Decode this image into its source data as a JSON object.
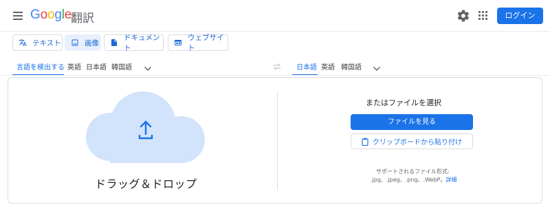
{
  "header": {
    "logo": {
      "g1": "G",
      "o1": "o",
      "o2": "o",
      "g2": "g",
      "l": "l",
      "e": "e"
    },
    "product": "翻訳",
    "login_label": "ログイン"
  },
  "modes": [
    {
      "label": "テキスト",
      "icon": "translate-icon",
      "active": false
    },
    {
      "label": "画像",
      "icon": "image-icon",
      "active": true
    },
    {
      "label": "ドキュメント",
      "icon": "document-icon",
      "active": false
    },
    {
      "label": "ウェブサイト",
      "icon": "website-icon",
      "active": false
    }
  ],
  "source_langs": [
    "言語を検出する",
    "英語",
    "日本語",
    "韓国語"
  ],
  "source_active": "言語を検出する",
  "target_langs": [
    "日本語",
    "英語",
    "韓国語"
  ],
  "target_active": "日本語",
  "upload": {
    "drag_label": "ドラッグ＆ドロップ",
    "select_label": "またはファイルを選択",
    "browse_label": "ファイルを見る",
    "paste_label": "クリップボードから貼り付け",
    "supported_title": "サポートされるファイル形式:",
    "formats": ".jpg、.jpeg、.png、.WebP。",
    "details_label": "詳細"
  },
  "colors": {
    "accent": "#1a73e8",
    "cloud": "#d2e3fc",
    "active_bg": "#e8f0fe"
  }
}
